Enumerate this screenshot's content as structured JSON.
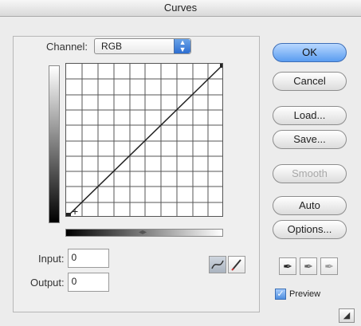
{
  "window": {
    "title": "Curves"
  },
  "channel": {
    "label": "Channel:",
    "value": "RGB"
  },
  "buttons": {
    "ok": "OK",
    "cancel": "Cancel",
    "load": "Load...",
    "save": "Save...",
    "smooth": "Smooth",
    "auto": "Auto",
    "options": "Options..."
  },
  "inputs": {
    "input_label": "Input:",
    "input_value": "0",
    "output_label": "Output:",
    "output_value": "0"
  },
  "preview": {
    "label": "Preview",
    "checked": true
  },
  "icons": {
    "channel_dropdown": "up-down-arrow-icon",
    "curve_tool": "curve-point-tool-icon",
    "pencil_tool": "pencil-icon",
    "black_eyedropper": "black-eyedropper-icon",
    "gray_eyedropper": "gray-eyedropper-icon",
    "white_eyedropper": "white-eyedropper-icon",
    "resize": "resize-grip-icon"
  },
  "colors": {
    "ok_button": "#5a9cf0",
    "checkbox": "#4c8ddf"
  }
}
